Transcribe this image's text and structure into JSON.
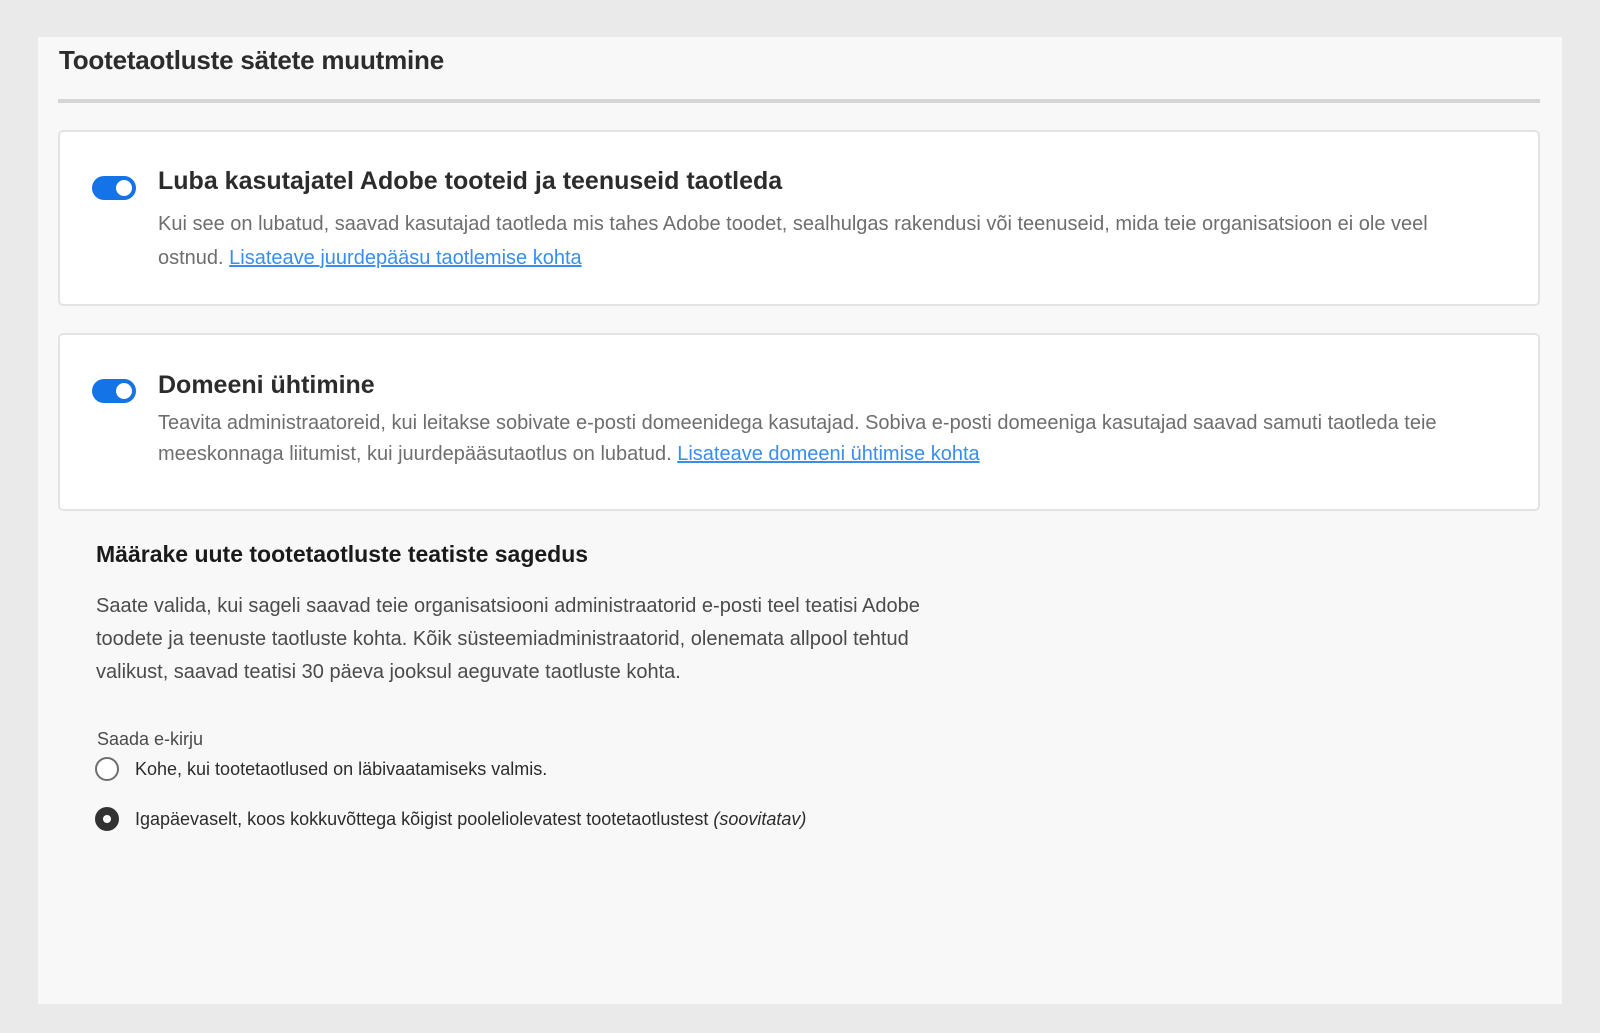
{
  "page": {
    "title": "Tootetaotluste sätete muutmine"
  },
  "access_request": {
    "enabled": true,
    "title": "Luba kasutajatel Adobe tooteid ja teenuseid taotleda",
    "description": "Kui see on lubatud, saavad kasutajad taotleda mis tahes Adobe toodet, sealhulgas rakendusi või teenuseid, mida teie organisatsioon ei ole veel ostnud.",
    "link_label": "Lisateave juurdepääsu taotlemise kohta"
  },
  "domain_matching": {
    "enabled": true,
    "title": "Domeeni ühtimine",
    "description": "Teavita administraatoreid, kui leitakse sobivate e-posti domeenidega kasutajad. Sobiva e-posti domeeniga kasutajad saavad samuti taotleda teie meeskonnaga liitumist, kui juurdepääsutaotlus on lubatud.",
    "link_label": "Lisateave domeeni ühtimise kohta"
  },
  "notifications": {
    "heading": "Määrake uute tootetaotluste teatiste sagedus",
    "description": "Saate valida, kui sageli saavad teie organisatsiooni administraatorid e-posti teel teatisi Adobe toodete ja teenuste taotluste kohta. Kõik süsteemiadministraatorid, olenemata allpool tehtud valikust, saavad teatisi 30 päeva jooksul aeguvate taotluste kohta.",
    "field_label": "Saada e-kirju",
    "options": [
      {
        "label": "Kohe, kui tootetaotlused on läbivaatamiseks valmis.",
        "suffix": "",
        "selected": false
      },
      {
        "label": "Igapäevaselt, koos kokkuvõttega kõigist pooleliolevatest tootetaotlustest",
        "suffix": "(soovitatav)",
        "selected": true
      }
    ]
  },
  "colors": {
    "accent": "#1473e6",
    "link": "#378ef0",
    "background": "#eaeaea",
    "panel": "#f8f8f8"
  }
}
